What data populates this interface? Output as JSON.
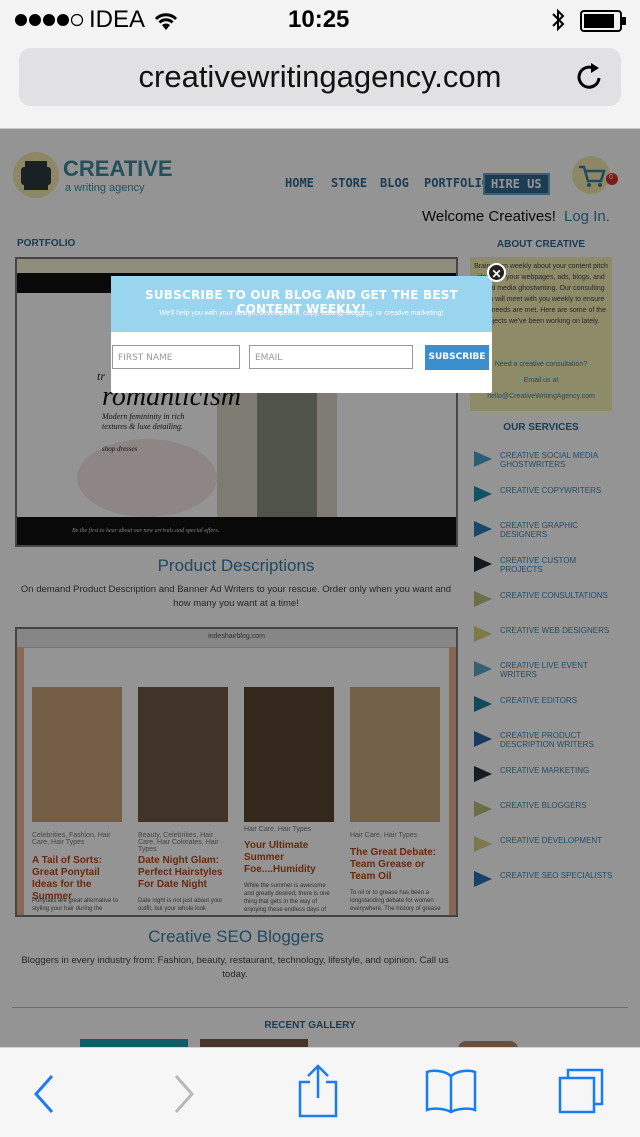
{
  "status_bar": {
    "carrier": "IDEA",
    "time": "10:25"
  },
  "browser": {
    "url": "creativewritingagency.com"
  },
  "site": {
    "logo_title": "CREATIVE",
    "logo_subtitle": "a writing agency",
    "nav": [
      "HOME",
      "STORE",
      "BLOG",
      "PORTFOLIO",
      "HIRE US"
    ],
    "cart_count": "0",
    "welcome": "Welcome Creatives!",
    "login": "Log In.",
    "portfolio_heading": "PORTFOLIO",
    "banner_text": "Be the first to hear about our new arrivals and special offers.",
    "hero_word": "romanticism",
    "hero_prefix": "tr",
    "hero_desc1": "Modern femininity in rich",
    "hero_desc2": "textures & luxe detailing.",
    "hero_shop": "shop dresses",
    "section1_title": "Product Descriptions",
    "section1_text": "On demand Product Description and Banner Ad Writers to your rescue. Order only when you want and how many you want at a time!",
    "blog_url": "indeshairblog.com",
    "cards": [
      {
        "tags": "Celebrities, Fashion, Hair Care, Hair Types",
        "title": "A Tail of Sorts: Great Ponytail Ideas for the Summer",
        "body": "Ponytails are great alternative to styling your hair during the"
      },
      {
        "tags": "Beauty, Celebrities, Hair Care, Hair Colorates, Hair Types",
        "title": "Date Night Glam: Perfect Hairstyles For Date Night",
        "body": "Date night is not just about your outfit, but your whole look"
      },
      {
        "tags": "Hair Care, Hair Types",
        "title": "Your Ultimate Summer Foe....Humidity",
        "body": "While the summer is awesome and greatly desired, there is one thing that gets in the way of enjoying these endless days of sun and"
      },
      {
        "tags": "Hair Care, Hair Types",
        "title": "The Great Debate: Team Grease or Team Oil",
        "body": "To oil or to grease has been a longstanding debate for women everywhere. The history of grease"
      }
    ],
    "section2_title": "Creative SEO Bloggers",
    "section2_text": "Bloggers in every industry from: Fashion, beauty, restaurant, technology, lifestyle, and opinion. Call us today.",
    "recent_gallery": "RECENT GALLERY",
    "about_heading": "ABOUT CREATIVE",
    "about_text": "Brainstorm weekly about your content pitch ideas for your webpages, ads, blogs, and social media ghostwriting. Our consulting team will meet with you weekly to ensure your needs are met. Here are some of the projects we've been working on lately.",
    "about_need": "Need a creative consultation?",
    "about_email_label": "Email us at",
    "about_email": "hello@CreativeWritingAgency.com",
    "services_heading": "OUR SERVICES",
    "services": [
      {
        "label": "CREATIVE SOCIAL MEDIA GHOSTWRITERS",
        "color": "#4aa3c9"
      },
      {
        "label": "CREATIVE COPYWRITERS",
        "color": "#1d8fb0"
      },
      {
        "label": "CREATIVE GRAPHIC DESIGNERS",
        "color": "#2a7bb5"
      },
      {
        "label": "CREATIVE CUSTOM PROJECTS",
        "color": "#1f2a33"
      },
      {
        "label": "CREATIVE CONSULTATIONS",
        "color": "#b9c27d"
      },
      {
        "label": "CREATIVE WEB DESIGNERS",
        "color": "#d8d27a"
      },
      {
        "label": "CREATIVE LIVE EVENT WRITERS",
        "color": "#5ea8c7"
      },
      {
        "label": "CREATIVE EDITORS",
        "color": "#1e7fa1"
      },
      {
        "label": "CREATIVE PRODUCT DESCRIPTION WRITERS",
        "color": "#2b63a5"
      },
      {
        "label": "CREATIVE MARKETING",
        "color": "#26313a"
      },
      {
        "label": "CREATIVE BLOGGERS",
        "color": "#b5bd79"
      },
      {
        "label": "CREATIVE DEVELOPMENT",
        "color": "#d6d18a"
      },
      {
        "label": "CREATIVE SEO SPECIALISTS",
        "color": "#2a6fb7"
      }
    ]
  },
  "popup": {
    "title": "SUBSCRIBE TO OUR BLOG AND GET THE BEST CONTENT WEEKLY!",
    "subtitle": "We'll help you with your design, development, copy, editing, blogging, or creative marketing!",
    "first_name_placeholder": "FIRST NAME",
    "email_placeholder": "EMAIL",
    "subscribe_label": "SUBSCRIBE",
    "close_label": "✕"
  }
}
